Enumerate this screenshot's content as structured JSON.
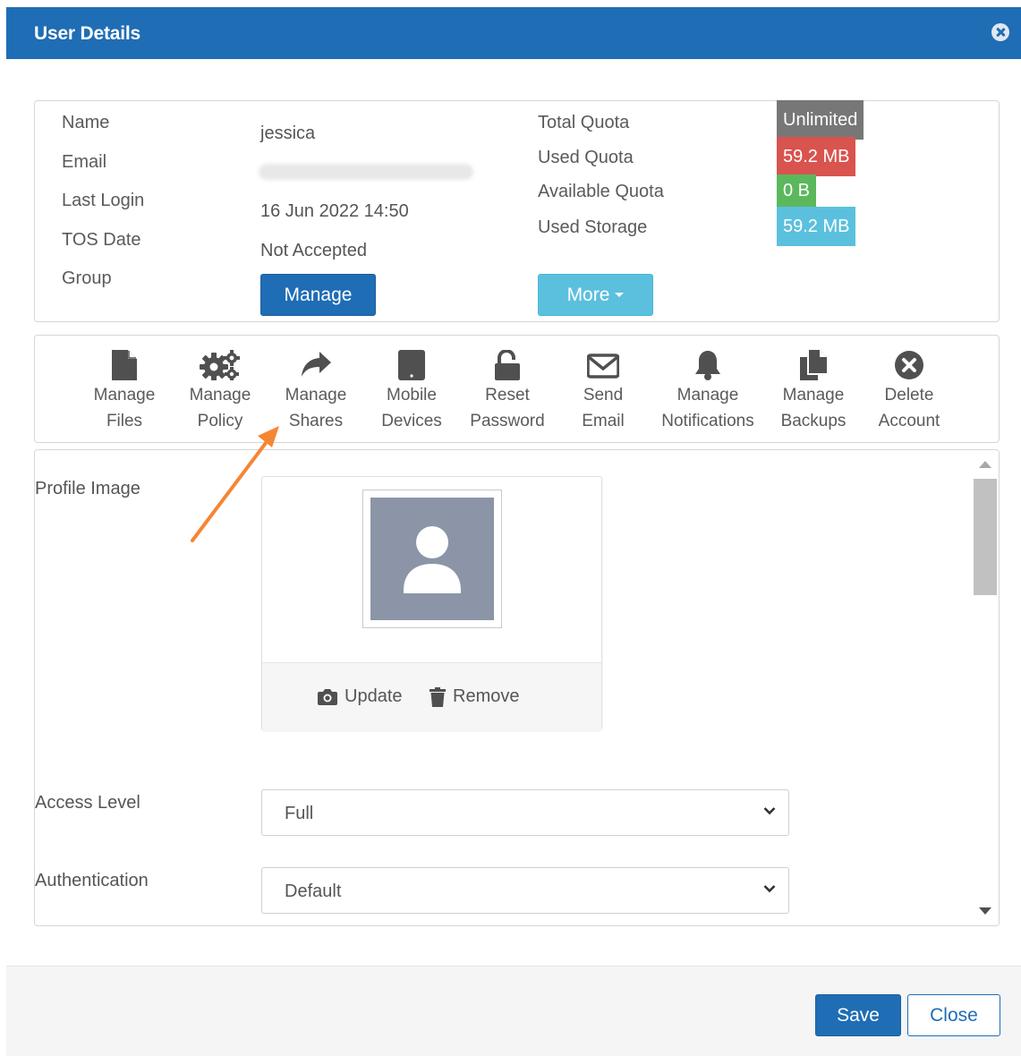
{
  "dialog": {
    "title": "User Details"
  },
  "info": {
    "labels": {
      "name": "Name",
      "email": "Email",
      "last_login": "Last Login",
      "tos_date": "TOS Date",
      "group": "Group"
    },
    "values": {
      "name": "jessica",
      "last_login": "16 Jun 2022 14:50",
      "tos_date": "Not Accepted"
    },
    "quota_labels": {
      "total": "Total Quota",
      "used": "Used Quota",
      "available": "Available Quota",
      "storage": "Used Storage"
    },
    "quota_values": {
      "total": "Unlimited",
      "used": "59.2 MB",
      "available": "0 B",
      "storage": "59.2 MB"
    },
    "manage_label": "Manage",
    "more_label": "More"
  },
  "toolbar": {
    "items": [
      {
        "label": "Manage\nFiles",
        "icon": "file-icon"
      },
      {
        "label": "Manage\nPolicy",
        "icon": "gears-icon"
      },
      {
        "label": "Manage\nShares",
        "icon": "share-icon"
      },
      {
        "label": "Mobile\nDevices",
        "icon": "tablet-icon"
      },
      {
        "label": "Reset\nPassword",
        "icon": "unlock-icon"
      },
      {
        "label": "Send\nEmail",
        "icon": "envelope-icon"
      },
      {
        "label": "Manage\nNotifications",
        "icon": "bell-icon"
      },
      {
        "label": "Manage\nBackups",
        "icon": "copy-icon"
      },
      {
        "label": "Delete\nAccount",
        "icon": "times-circle-icon"
      }
    ]
  },
  "profile": {
    "label": "Profile Image",
    "update_label": "Update",
    "remove_label": "Remove"
  },
  "access_level": {
    "label": "Access Level",
    "value": "Full"
  },
  "authentication": {
    "label": "Authentication",
    "value": "Default"
  },
  "footer": {
    "save_label": "Save",
    "close_label": "Close"
  },
  "colors": {
    "primary": "#1f6db5",
    "badge_unlimited": "#777777",
    "badge_used": "#d9534f",
    "badge_available": "#5cb85c",
    "badge_storage": "#5bc0de",
    "annotation_arrow": "#f58634"
  }
}
